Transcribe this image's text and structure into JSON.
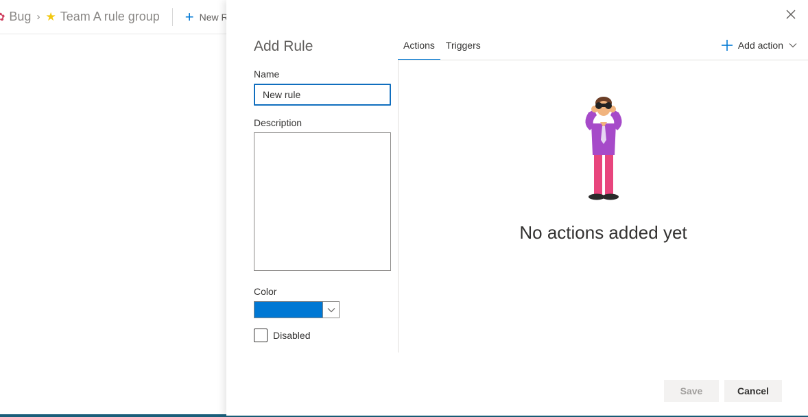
{
  "background": {
    "breadcrumb": [
      {
        "label": "Bug",
        "icon": "bug-icon"
      },
      {
        "label": "Team A rule group",
        "icon": "star-icon"
      }
    ],
    "new_button_label": "New R"
  },
  "panel": {
    "title": "Add Rule",
    "tabs": [
      {
        "label": "Actions",
        "active": true
      },
      {
        "label": "Triggers",
        "active": false
      }
    ],
    "add_action_label": "Add action",
    "form": {
      "name_label": "Name",
      "name_value": "New rule",
      "description_label": "Description",
      "description_value": "",
      "color_label": "Color",
      "color_value": "#0078d4",
      "disabled_label": "Disabled",
      "disabled_checked": false
    },
    "empty_state": {
      "message": "No actions added yet",
      "illustration": "person-with-binoculars"
    },
    "footer": {
      "save_label": "Save",
      "cancel_label": "Cancel"
    }
  },
  "colors": {
    "accent": "#0078d4",
    "text": "#323130",
    "muted": "#605e5c"
  }
}
